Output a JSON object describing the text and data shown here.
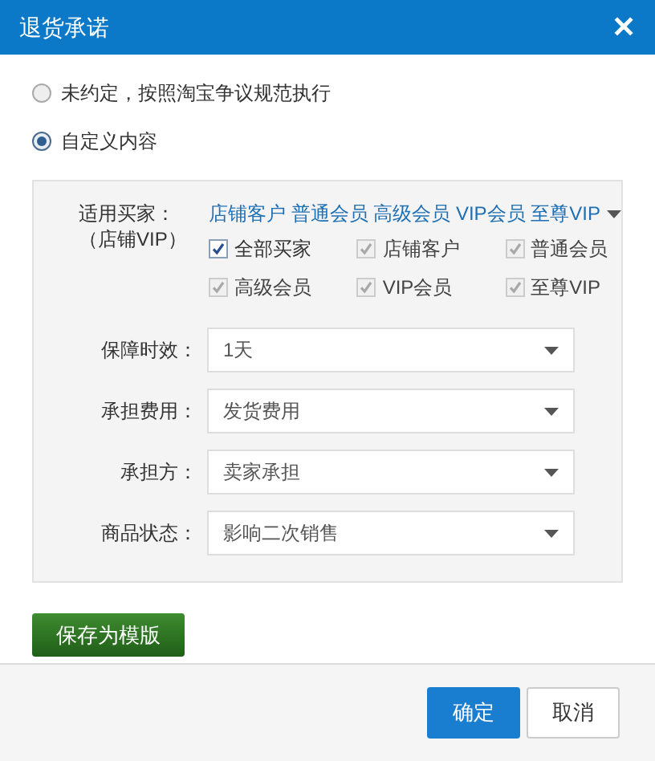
{
  "window": {
    "title": "退货承诺",
    "close": "✕"
  },
  "options": [
    {
      "label": "未约定，按照淘宝争议规范执行",
      "selected": false
    },
    {
      "label": "自定义内容",
      "selected": true
    }
  ],
  "buyers": {
    "label": "适用买家：",
    "sublabel": "（店铺VIP）",
    "summary": "店铺客户 普通会员 高级会员 VIP会员 至尊VIP",
    "checkboxes": [
      {
        "label": "全部买家",
        "checked": true,
        "disabled": false
      },
      {
        "label": "店铺客户",
        "checked": true,
        "disabled": true
      },
      {
        "label": "普通会员",
        "checked": true,
        "disabled": true
      },
      {
        "label": "高级会员",
        "checked": true,
        "disabled": true
      },
      {
        "label": "VIP会员",
        "checked": true,
        "disabled": true
      },
      {
        "label": "至尊VIP",
        "checked": true,
        "disabled": true
      }
    ]
  },
  "fields": [
    {
      "label": "保障时效：",
      "value": "1天"
    },
    {
      "label": "承担费用：",
      "value": "发货费用"
    },
    {
      "label": "承担方：",
      "value": "卖家承担"
    },
    {
      "label": "商品状态：",
      "value": "影响二次销售"
    }
  ],
  "save_button": "保存为模版",
  "footer_buttons": [
    {
      "label": "确定",
      "kind": "primary"
    },
    {
      "label": "取消",
      "kind": "secondary"
    }
  ]
}
